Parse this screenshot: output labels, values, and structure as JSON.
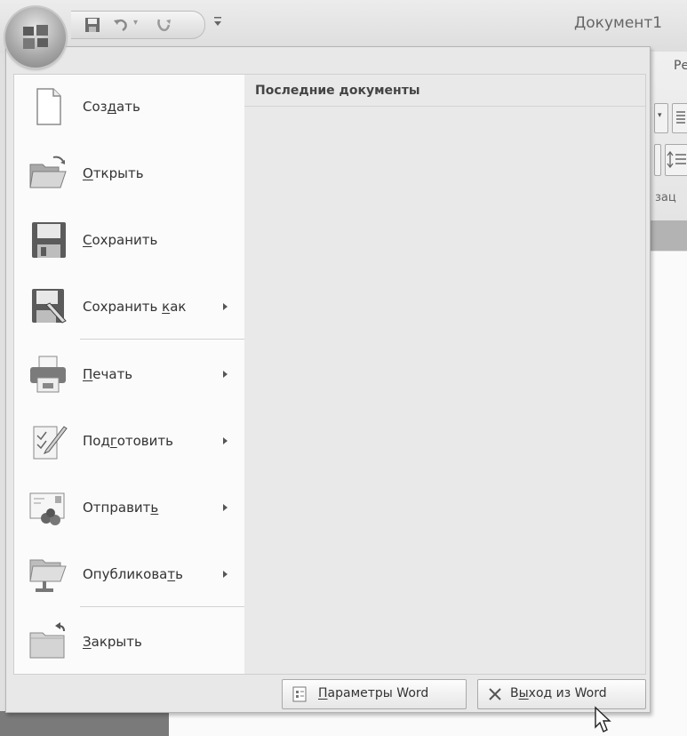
{
  "window": {
    "title": "Документ1",
    "ribbon_tab_partial": "Ре",
    "ribbon_group_partial": "зац"
  },
  "quick_access": {
    "items": [
      "save-icon",
      "undo-icon",
      "redo-icon",
      "customize-dropdown-icon"
    ]
  },
  "office_menu": {
    "commands": [
      {
        "name": "new",
        "pre": "Соз",
        "key": "д",
        "post": "ать",
        "has_submenu": false,
        "icon": "new-document-icon"
      },
      {
        "name": "open",
        "pre": "",
        "key": "О",
        "post": "ткрыть",
        "has_submenu": false,
        "icon": "open-folder-icon"
      },
      {
        "name": "save",
        "pre": "",
        "key": "С",
        "post": "охранить",
        "has_submenu": false,
        "icon": "save-disk-icon"
      },
      {
        "name": "save-as",
        "pre": "Сохранить ",
        "key": "к",
        "post": "ак",
        "has_submenu": true,
        "icon": "save-as-icon"
      },
      {
        "name": "print",
        "pre": "",
        "key": "П",
        "post": "ечать",
        "has_submenu": true,
        "icon": "printer-icon"
      },
      {
        "name": "prepare",
        "pre": "Под",
        "key": "г",
        "post": "отовить",
        "has_submenu": true,
        "icon": "prepare-document-icon"
      },
      {
        "name": "send",
        "pre": "Отправит",
        "key": "ь",
        "post": "",
        "has_submenu": true,
        "icon": "send-envelope-icon"
      },
      {
        "name": "publish",
        "pre": "Опубликова",
        "key": "т",
        "post": "ь",
        "has_submenu": true,
        "icon": "publish-icon"
      },
      {
        "name": "close",
        "pre": "",
        "key": "З",
        "post": "акрыть",
        "has_submenu": false,
        "icon": "close-folder-icon"
      }
    ],
    "recent_documents_title": "Последние документы",
    "options_button": {
      "pre": "",
      "key": "П",
      "post": "араметры Word"
    },
    "exit_button": {
      "pre": "В",
      "key": "ы",
      "post": "ход из Word"
    }
  }
}
